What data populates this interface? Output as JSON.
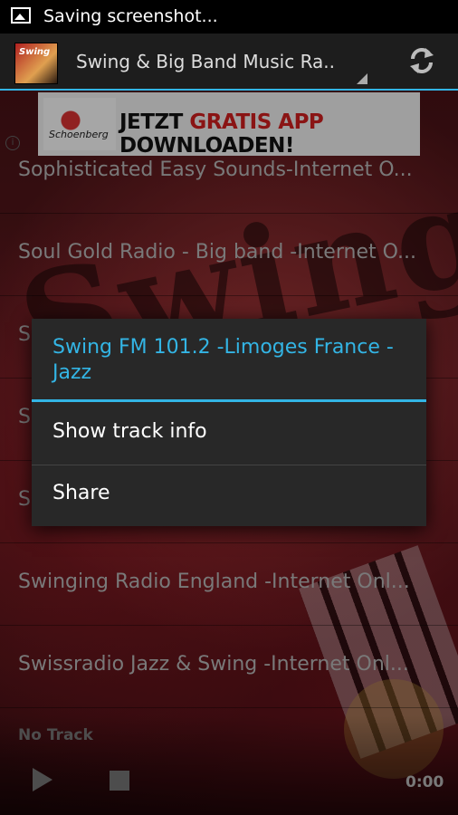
{
  "status_bar": {
    "notification_text": "Saving screenshot..."
  },
  "action_bar": {
    "title": "Swing & Big Band Music Ra..",
    "logo_text": "Swing"
  },
  "ad": {
    "brand_text": "Schoenberg",
    "headline_white": "JETZT ",
    "headline_red": "GRATIS APP ",
    "headline_end": "DOWNLOADEN!"
  },
  "stations": [
    "Sophisticated Easy Sounds-Internet O...",
    "Soul Gold Radio - Big band -Internet O...",
    "S",
    "S",
    "S",
    "Swinging Radio England -Internet Onl...",
    "Swissradio Jazz & Swing -Internet Onl..."
  ],
  "dialog": {
    "title": "Swing FM 101.2 -Limoges France -Jazz",
    "options": [
      "Show track info",
      "Share"
    ]
  },
  "player": {
    "track_label": "No Track",
    "time": "0:00"
  },
  "colors": {
    "accent": "#33b5e5",
    "dialog_bg": "#282828",
    "action_bar_bg": "#1d1d1d"
  },
  "icons": [
    "image-icon",
    "refresh-icon",
    "info-icon",
    "play-icon",
    "stop-icon"
  ]
}
